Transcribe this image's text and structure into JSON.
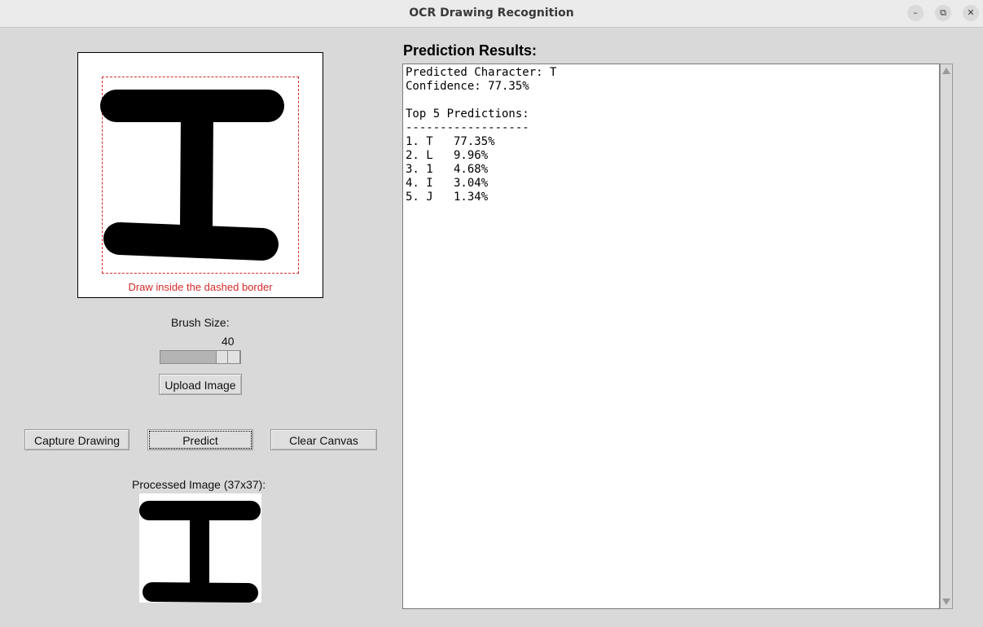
{
  "window": {
    "title": "OCR Drawing Recognition",
    "controls": [
      "minimize-icon",
      "restore-icon",
      "close-icon"
    ]
  },
  "canvas": {
    "hint": "Draw inside the dashed border",
    "drawn_character": "I"
  },
  "brush": {
    "label": "Brush Size:",
    "value": "40"
  },
  "buttons": {
    "upload": "Upload Image",
    "capture": "Capture Drawing",
    "predict": "Predict",
    "clear": "Clear Canvas"
  },
  "processed": {
    "label": "Processed Image (37x37):"
  },
  "results": {
    "title": "Prediction Results:",
    "predicted_line": "Predicted Character: T",
    "confidence_line": "Confidence: 77.35%",
    "top5_header": "Top 5 Predictions:",
    "separator": "------------------",
    "predictions": [
      "1. T   77.35%",
      "2. L   9.96%",
      "3. 1   4.68%",
      "4. I   3.04%",
      "5. J   1.34%"
    ]
  },
  "colors": {
    "accent_red": "#d42a2a",
    "window_bg": "#d9d9d9"
  }
}
